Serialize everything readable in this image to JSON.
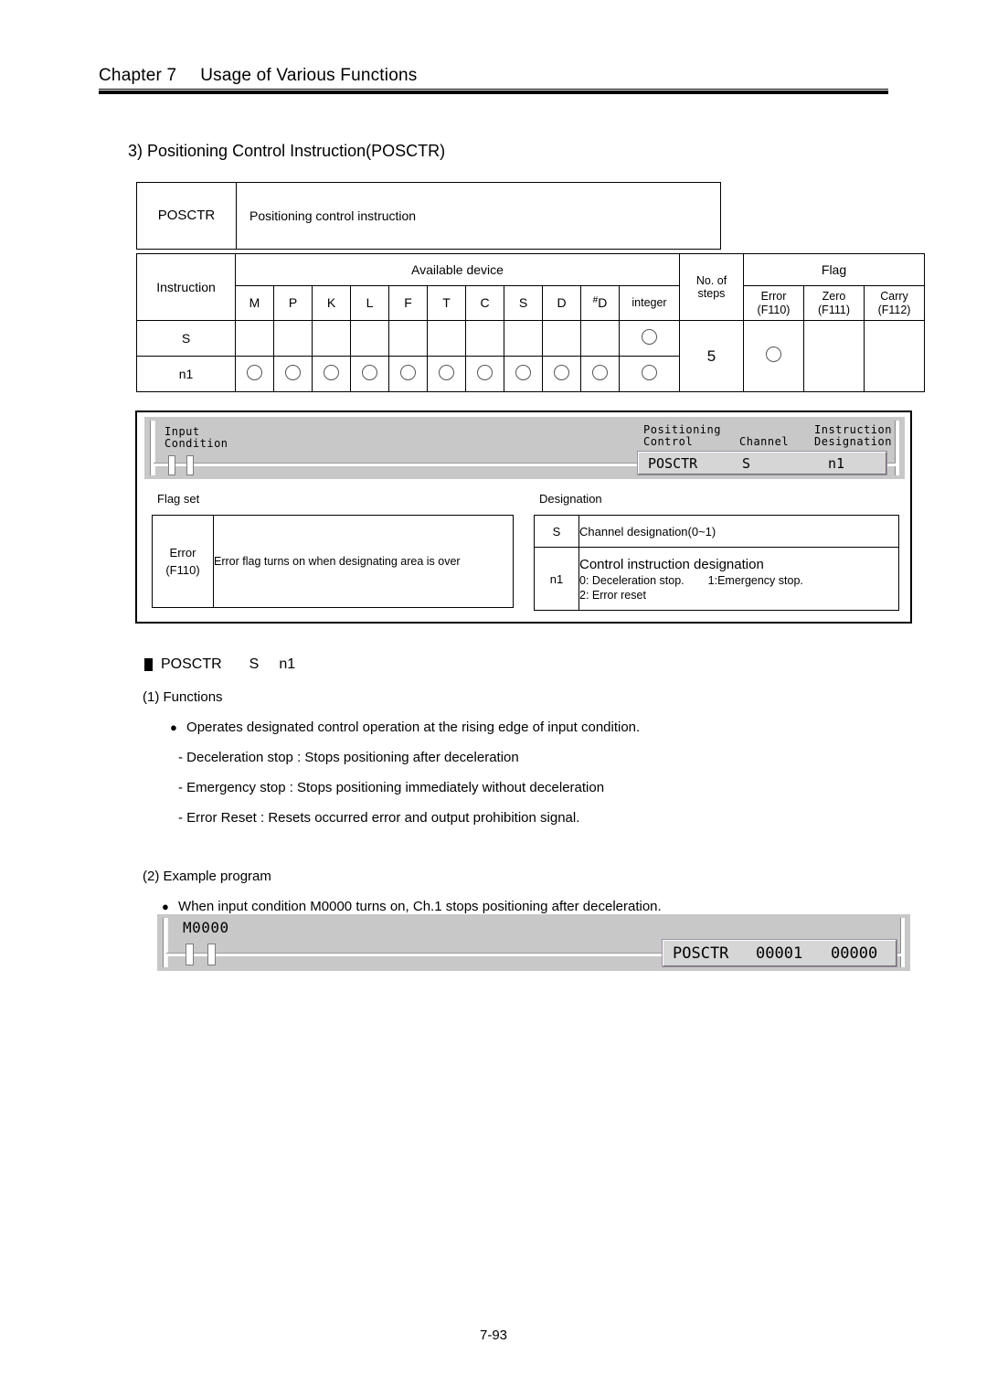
{
  "header": {
    "chapter": "Chapter 7",
    "title": "Usage of Various Functions"
  },
  "section_title": "3) Positioning Control Instruction(POSCTR)",
  "spec_table": {
    "name": "POSCTR",
    "description": "Positioning control instruction",
    "col_instruction": "Instruction",
    "group_available_device": "Available device",
    "device_columns": [
      "M",
      "P",
      "K",
      "L",
      "F",
      "T",
      "C",
      "S",
      "D",
      "#D",
      "integer"
    ],
    "col_steps_line1": "No. of",
    "col_steps_line2": "steps",
    "group_flag": "Flag",
    "flag_columns": [
      {
        "name": "Error",
        "code": "(F110)"
      },
      {
        "name": "Zero",
        "code": "(F111)"
      },
      {
        "name": "Carry",
        "code": "(F112)"
      }
    ],
    "rows": [
      {
        "operand": "S",
        "devices": [
          false,
          false,
          false,
          false,
          false,
          false,
          false,
          false,
          false,
          false,
          true
        ]
      },
      {
        "operand": "n1",
        "devices": [
          true,
          true,
          true,
          true,
          true,
          true,
          true,
          true,
          true,
          true,
          true
        ]
      }
    ],
    "steps_value": "5",
    "flag_values": [
      true,
      false,
      false
    ]
  },
  "ladder_top": {
    "input_condition_line1": "Input",
    "input_condition_line2": "Condition",
    "label_positioning_line1": "Positioning",
    "label_positioning_line2": "Control",
    "label_channel": "Channel",
    "label_instruction_line1": "Instruction",
    "label_instruction_line2": "Designation",
    "box_instruction": "POSCTR",
    "box_operand_s": "S",
    "box_operand_n1": "n1"
  },
  "flag_set": {
    "caption": "Flag set",
    "key_line1": "Error",
    "key_line2": "(F110)",
    "value": "Error flag turns on when designating area is over"
  },
  "designation": {
    "caption": "Designation",
    "rows": [
      {
        "key": "S",
        "text": "Channel designation(0~1)"
      }
    ],
    "n1_key": "n1",
    "n1_title": "Control instruction designation",
    "n1_line2_a": "0: Deceleration stop.",
    "n1_line2_b": "1:Emergency stop.",
    "n1_line3": "2: Error reset"
  },
  "body": {
    "syntax_name": "POSCTR",
    "syntax_op1": "S",
    "syntax_op2": "n1",
    "functions_heading": "(1) Functions",
    "functions_bullet": "Operates designated control operation at the rising edge of input condition.",
    "functions_items": [
      "- Deceleration stop : Stops positioning after deceleration",
      "- Emergency stop : Stops positioning immediately without deceleration",
      "- Error Reset : Resets occurred error and output prohibition signal."
    ],
    "example_heading": "(2) Example program",
    "example_bullet": "When input condition M0000 turns on, Ch.1 stops positioning after deceleration."
  },
  "ladder_bottom": {
    "contact_label": "M0000",
    "box_instruction": "POSCTR",
    "box_operand_s": "00001",
    "box_operand_n1": "00000"
  },
  "footer": {
    "page_number": "7-93"
  }
}
